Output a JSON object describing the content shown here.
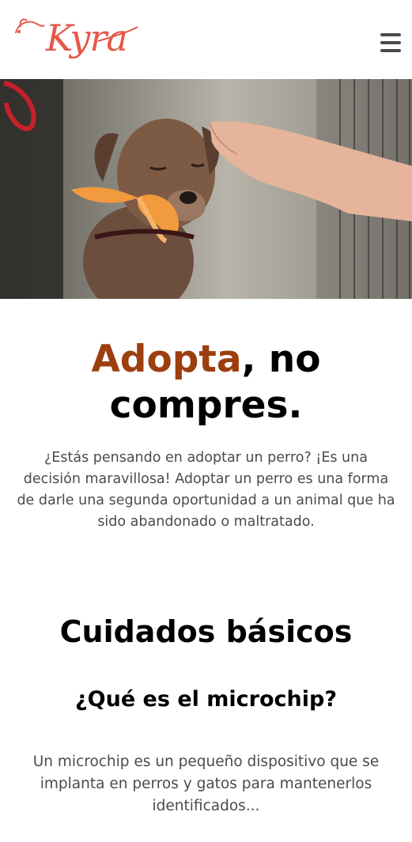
{
  "header": {
    "logo_text": "Kyra",
    "menu_icon": "hamburger-menu-icon",
    "brand_color": "#e8574a"
  },
  "hero": {
    "image_description_icon": "dog-photo"
  },
  "headline": {
    "accent": "Adopta",
    "rest_line1": ", no",
    "line2": "compres.",
    "accent_color": "#9c3e0e"
  },
  "intro": "¿Estás pensando en adoptar un perro? ¡Es una decisión maravillosa! Adoptar un perro es una forma de darle una segunda oportunidad a un animal que ha sido abandonado o maltratado.",
  "section": {
    "title": "Cuidados básicos",
    "subtitle": "¿Qué es el microchip?",
    "text": "Un microchip es un pequeño dispositivo que se implanta en perros y gatos para mantenerlos identificados..."
  }
}
